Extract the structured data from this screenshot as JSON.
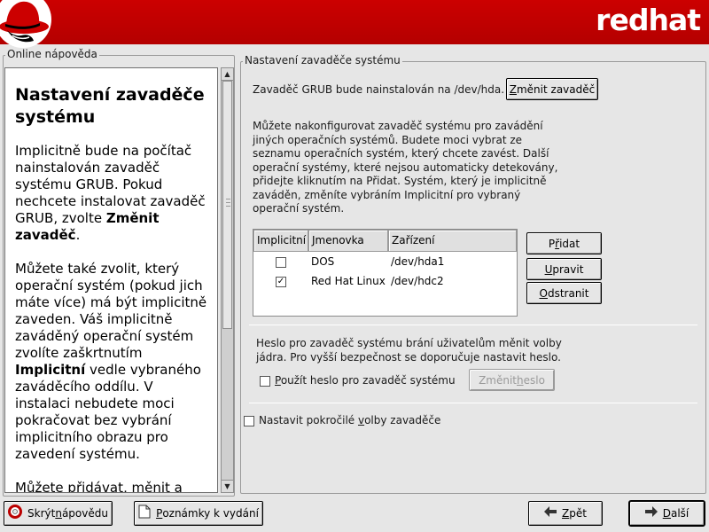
{
  "header": {
    "brand": "redhat"
  },
  "help": {
    "frame_title": "Online nápověda",
    "heading": "Nastavení zavaděče systému",
    "paragraphs": [
      {
        "before": "Implicitně bude na počítač nainstalován zavaděč systému GRUB. Pokud nechcete instalovat zavaděč GRUB, zvolte ",
        "bold": "Změnit zavaděč",
        "after": "."
      },
      {
        "before": "Můžete také zvolit, který operační systém (pokud jich máte více) má být implicitně zaveden. Váš implicitně zaváděný operační systém zvolíte zaškrtnutím ",
        "bold": "Implicitní",
        "after": " vedle vybraného zaváděcího oddílu. V instalaci nebudete moci pokračovat bez vybrání implicitního obrazu pro zavedení systému."
      },
      {
        "before": "Můžete přidávat, měnit a odstraňovat položky zavaděče výběrem oddílu pomocí myši a",
        "bold": "",
        "after": ""
      }
    ]
  },
  "main": {
    "frame_title": "Nastavení zavaděče systému",
    "grub_line": "Zavaděč GRUB bude nainstalován na /dev/hda.",
    "change_loader_button": {
      "pre": "",
      "u": "Z",
      "post": "měnit zavaděč"
    },
    "info_text": "Můžete nakonfigurovat zavaděč systému pro zavádění jiných operačních systémů. Budete moci vybrat ze seznamu operačních systém, který chcete zavést. Další operační systémy, které nejsou automaticky detekovány, přidejte kliknutím na Přidat. Systém, který je implicitně zaváděn, změníte vybráním Implicitní pro vybraný operační systém.",
    "table": {
      "headers": [
        "Implicitní",
        "Jmenovka",
        "Zařízení"
      ],
      "rows": [
        {
          "default": false,
          "label": "DOS",
          "device": "/dev/hda1"
        },
        {
          "default": true,
          "label": "Red Hat Linux",
          "device": "/dev/hdc2"
        }
      ]
    },
    "add_button": {
      "pre": "P",
      "u": "ř",
      "post": "idat"
    },
    "edit_button": {
      "pre": "",
      "u": "U",
      "post": "pravit"
    },
    "delete_button": {
      "pre": "",
      "u": "O",
      "post": "dstranit"
    },
    "password_text": "Heslo pro zavaděč systému brání uživatelům měnit volby jádra. Pro vyšší bezpečnost se doporučuje nastavit heslo.",
    "use_password_checkbox": {
      "checked": false,
      "pre": "",
      "u": "P",
      "post": "oužít heslo pro zavaděč systému"
    },
    "change_password_button": {
      "pre": "Změnit ",
      "u": "h",
      "post": "eslo",
      "disabled": true
    },
    "advanced_checkbox": {
      "checked": false,
      "pre": "Nastavit pokročilé ",
      "u": "v",
      "post": "olby zavaděče"
    }
  },
  "footer": {
    "hide_help_button": {
      "pre": "Skrýt ",
      "u": "n",
      "post": "ápovědu"
    },
    "release_notes_button": {
      "pre": "",
      "u": "P",
      "post": "oznámky k vydání"
    },
    "back_button": {
      "pre": "",
      "u": "Z",
      "post": "pět"
    },
    "next_button": {
      "pre": "",
      "u": "D",
      "post": "alší"
    }
  },
  "icons": {
    "logo": "shadowman-hat-icon",
    "back": "arrow-left-icon",
    "next": "arrow-right-icon",
    "help": "lifebuoy-icon",
    "notes": "document-icon"
  },
  "colors": {
    "banner": "#cc0000",
    "window_bg": "#e6e6e6"
  }
}
